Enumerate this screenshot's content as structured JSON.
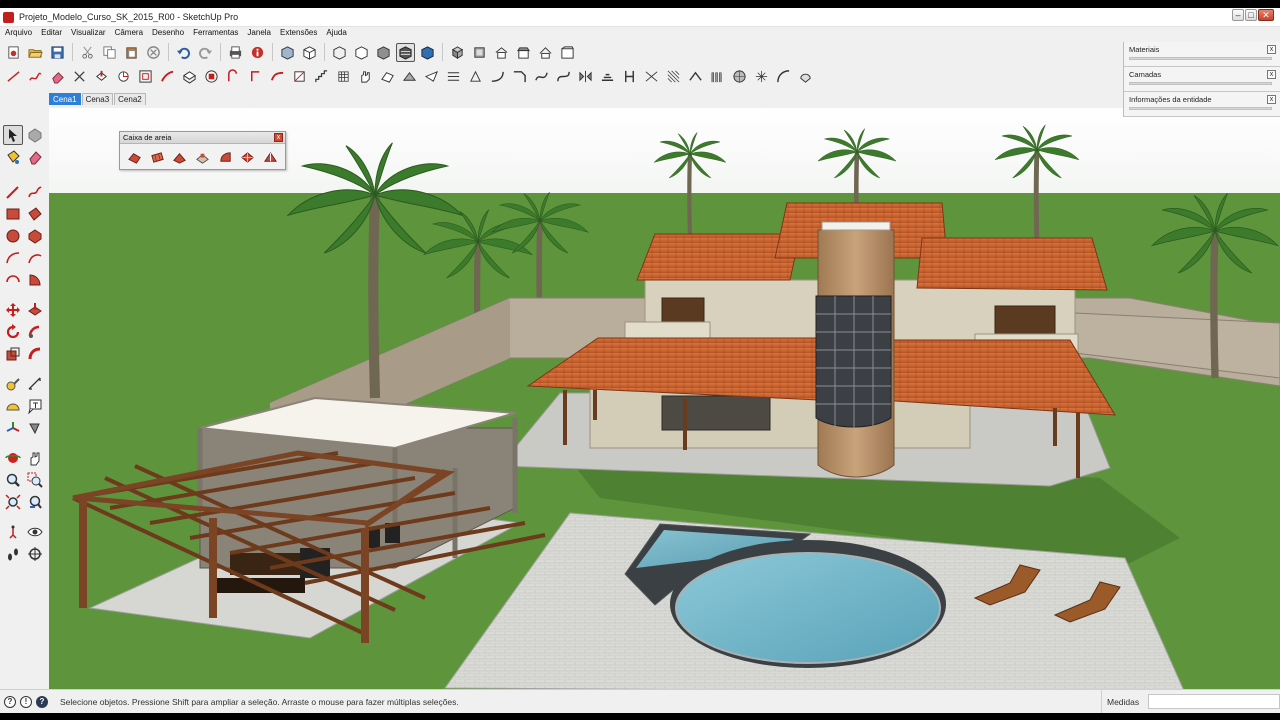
{
  "window": {
    "title": "Projeto_Modelo_Curso_SK_2015_R00 - SketchUp Pro",
    "controls": {
      "minimize": "–",
      "maximize": "□",
      "close": "✕"
    }
  },
  "menu": [
    "Arquivo",
    "Editar",
    "Visualizar",
    "Câmera",
    "Desenho",
    "Ferramentas",
    "Janela",
    "Extensões",
    "Ajuda"
  ],
  "scene_tabs": [
    {
      "label": "Cena1",
      "active": true
    },
    {
      "label": "Cena3",
      "active": false
    },
    {
      "label": "Cena2",
      "active": false
    }
  ],
  "sandbox_toolbar": {
    "title": "Caixa de areia",
    "close": "x"
  },
  "tray": {
    "panels": [
      {
        "label": "Materiais",
        "close": "x"
      },
      {
        "label": "Camadas",
        "close": "x"
      },
      {
        "label": "Informações da entidade",
        "close": "x"
      }
    ]
  },
  "status": {
    "message": "Selecione objetos. Pressione Shift para ampliar a seleção. Arraste o mouse para fazer múltiplas seleções.",
    "measurements_label": "Medidas",
    "measurements_value": "",
    "icons": [
      "geo-location-icon",
      "credits-icon",
      "help-icon"
    ]
  },
  "colors": {
    "sky": "#ffffff",
    "grass": "#5e953c",
    "roof_tile": "#c8622d",
    "wall": "#d7d1bd",
    "stone_column": "#b58f66",
    "pool_water": "#6fb0c4",
    "paving": "#d9d9d6",
    "wood": "#7a4425",
    "active_tab": "#2d7fd8"
  }
}
